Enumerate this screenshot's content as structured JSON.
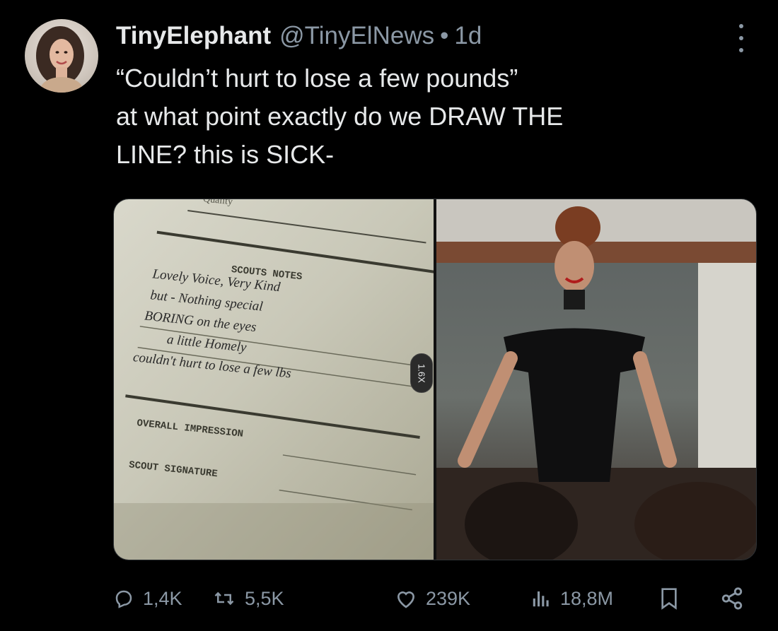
{
  "post": {
    "author_name": "TinyElephant",
    "author_handle": "@TinyElNews",
    "separator": "•",
    "time_ago": "1d",
    "text_lines": [
      "“Couldn’t hurt to lose a few pounds”",
      "at what point exactly do we DRAW THE",
      "LINE? this is SICK-"
    ]
  },
  "media": {
    "left_form": {
      "header_word": "Quality",
      "scouts_notes_label": "SCOUTS NOTES",
      "handwriting_lines": [
        "Lovely Voice, Very Kind",
        "but - Nothing special",
        "BORING on the eyes",
        "a little Homely",
        "couldn't hurt to lose a few lbs"
      ],
      "overall_impression_label": "OVERALL IMPRESSION",
      "scout_signature_label": "SCOUT SIGNATURE"
    },
    "zoom_badge": "1.6X"
  },
  "actions": {
    "replies": "1,4K",
    "retweets": "5,5K",
    "likes": "239K",
    "views": "18,8M"
  },
  "colors": {
    "background": "#000000",
    "text_primary": "#e7e9ea",
    "text_secondary": "#8b98a5"
  },
  "icons": [
    "more-icon",
    "reply-icon",
    "retweet-icon",
    "like-icon",
    "views-icon",
    "bookmark-icon",
    "share-icon"
  ]
}
